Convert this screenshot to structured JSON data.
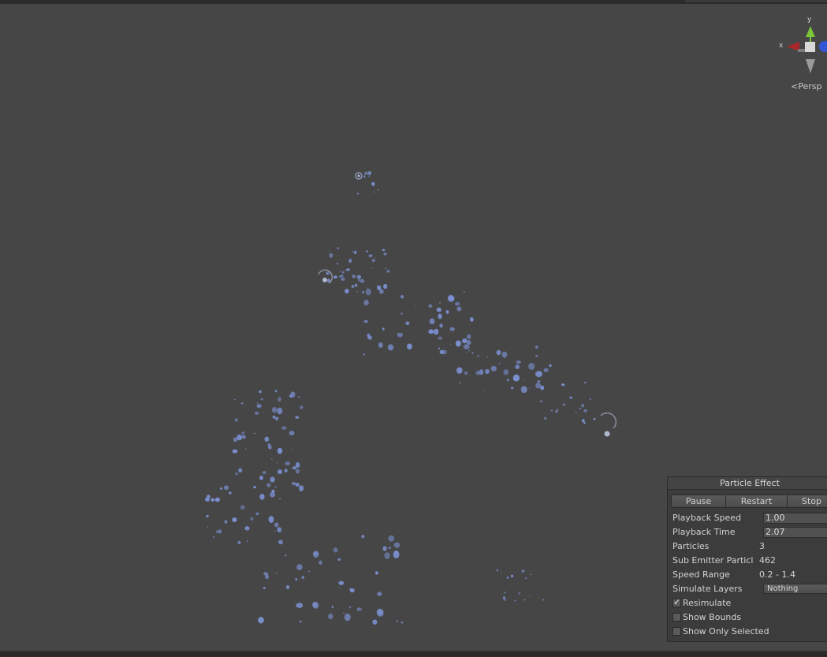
{
  "scene": {
    "particle_color": "#7b8fd0",
    "background_color": "#464646"
  },
  "gizmo": {
    "axis_x_label": "x",
    "axis_y_label": "y",
    "projection_label": "Persp",
    "x_color": "#a8282b",
    "y_color": "#7ec43a",
    "z_color": "#3455d6"
  },
  "panel": {
    "title": "Particle Effect",
    "buttons": {
      "pause": "Pause",
      "restart": "Restart",
      "stop": "Stop"
    },
    "playback_speed_label": "Playback Speed",
    "playback_speed_value": "1.00",
    "playback_time_label": "Playback Time",
    "playback_time_value": "2.07",
    "particles_label": "Particles",
    "particles_value": "3",
    "sub_emitter_label": "Sub Emitter Particl",
    "sub_emitter_value": "462",
    "speed_range_label": "Speed Range",
    "speed_range_value": "0.2 - 1.4",
    "simulate_layers_label": "Simulate Layers",
    "simulate_layers_value": "Nothing",
    "resimulate_label": "Resimulate",
    "resimulate_checked": true,
    "show_bounds_label": "Show Bounds",
    "show_bounds_checked": false,
    "show_only_selected_label": "Show Only Selected",
    "show_only_selected_checked": false
  }
}
